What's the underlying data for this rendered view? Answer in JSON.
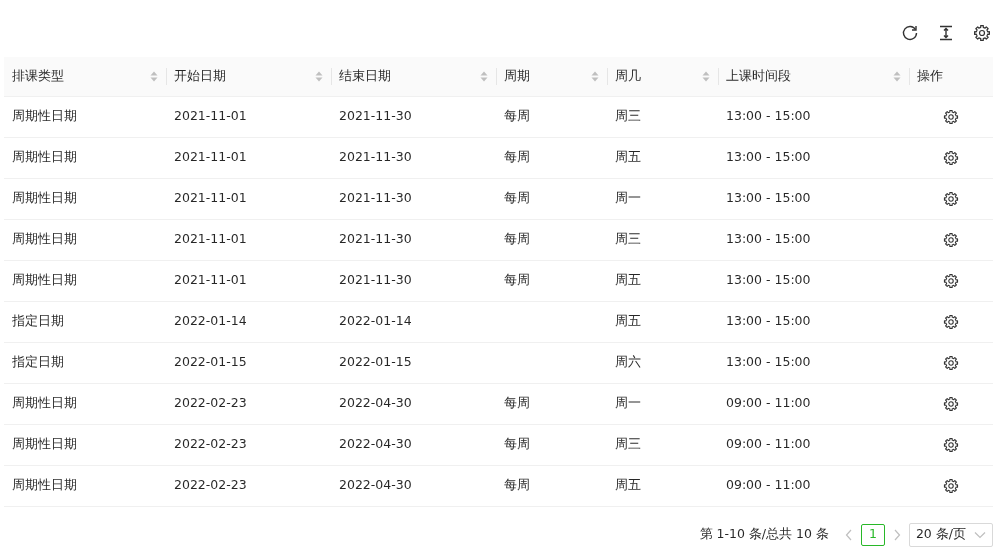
{
  "table": {
    "columns": [
      {
        "label": "排课类型",
        "sortable": true
      },
      {
        "label": "开始日期",
        "sortable": true
      },
      {
        "label": "结束日期",
        "sortable": true
      },
      {
        "label": "周期",
        "sortable": true
      },
      {
        "label": "周几",
        "sortable": true
      },
      {
        "label": "上课时间段",
        "sortable": true
      },
      {
        "label": "操作",
        "sortable": false
      }
    ],
    "rows": [
      [
        "周期性日期",
        "2021-11-01",
        "2021-11-30",
        "每周",
        "周三",
        "13:00 - 15:00"
      ],
      [
        "周期性日期",
        "2021-11-01",
        "2021-11-30",
        "每周",
        "周五",
        "13:00 - 15:00"
      ],
      [
        "周期性日期",
        "2021-11-01",
        "2021-11-30",
        "每周",
        "周一",
        "13:00 - 15:00"
      ],
      [
        "周期性日期",
        "2021-11-01",
        "2021-11-30",
        "每周",
        "周三",
        "13:00 - 15:00"
      ],
      [
        "周期性日期",
        "2021-11-01",
        "2021-11-30",
        "每周",
        "周五",
        "13:00 - 15:00"
      ],
      [
        "指定日期",
        "2022-01-14",
        "2022-01-14",
        "",
        "周五",
        "13:00 - 15:00"
      ],
      [
        "指定日期",
        "2022-01-15",
        "2022-01-15",
        "",
        "周六",
        "13:00 - 15:00"
      ],
      [
        "周期性日期",
        "2022-02-23",
        "2022-04-30",
        "每周",
        "周一",
        "09:00 - 11:00"
      ],
      [
        "周期性日期",
        "2022-02-23",
        "2022-04-30",
        "每周",
        "周三",
        "09:00 - 11:00"
      ],
      [
        "周期性日期",
        "2022-02-23",
        "2022-04-30",
        "每周",
        "周五",
        "09:00 - 11:00"
      ]
    ]
  },
  "pagination": {
    "summary": "第 1-10 条/总共 10 条",
    "pages": [
      {
        "label": "1",
        "selected": true
      }
    ],
    "page_size": "20 条/页"
  }
}
